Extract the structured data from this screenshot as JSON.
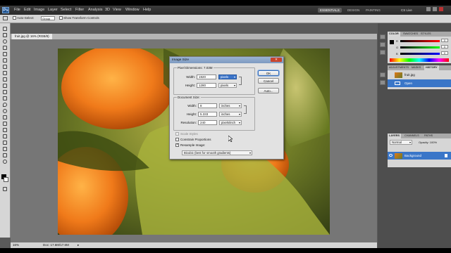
{
  "menu": [
    "File",
    "Edit",
    "Image",
    "Layer",
    "Select",
    "Filter",
    "Analysis",
    "3D",
    "View",
    "Window",
    "Help"
  ],
  "workspaces": {
    "essentials": "ESSENTIALS",
    "design": "DESIGN",
    "painting": "PAINTING",
    "cs_live": "CS Live"
  },
  "options_bar": {
    "auto_select_label": "Auto-Select:",
    "auto_select_value": "Group",
    "show_transform": "Show Transform Controls"
  },
  "document": {
    "tab": "fruit.jpg @ 16% (RGB/8)",
    "zoom": "16%",
    "doc_info": "Doc: 17.6M/17.6M"
  },
  "dialog": {
    "title": "Image Size",
    "pixel_dimensions": "Pixel Dimensions: 7.03M",
    "pixel_width_label": "Width:",
    "pixel_width_value": "1920",
    "pixel_width_unit": "pixels",
    "pixel_height_label": "Height:",
    "pixel_height_value": "1280",
    "pixel_height_unit": "pixels",
    "doc_size_label": "Document Size:",
    "doc_width_label": "Width:",
    "doc_width_value": "8",
    "doc_width_unit": "inches",
    "doc_height_label": "Height:",
    "doc_height_value": "5.333",
    "doc_height_unit": "inches",
    "resolution_label": "Resolution:",
    "resolution_value": "240",
    "resolution_unit": "pixels/inch",
    "scale_styles": "Scale Styles",
    "constrain": "Constrain Proportions",
    "resample": "Resample Image:",
    "resample_method": "Bicubic (best for smooth gradients)",
    "ok": "OK",
    "cancel": "Cancel",
    "auto": "Auto..."
  },
  "panels": {
    "color_tabs": [
      "COLOR",
      "SWATCHES",
      "STYLES"
    ],
    "sliders": [
      {
        "label": "R",
        "value": "0",
        "gradient": "linear-gradient(90deg,#000,#f00)"
      },
      {
        "label": "G",
        "value": "0",
        "gradient": "linear-gradient(90deg,#000,#0f0)"
      },
      {
        "label": "B",
        "value": "0",
        "gradient": "linear-gradient(90deg,#000,#00f)"
      }
    ],
    "history_tabs": [
      "ADJUSTMENTS",
      "MASKS",
      "HISTORY"
    ],
    "history_items": [
      "fruit.jpg",
      "Open"
    ],
    "layers_tabs": [
      "LAYERS",
      "CHANNELS",
      "PATHS"
    ],
    "blend_mode": "Normal",
    "opacity": "Opacity: 100%",
    "layer_name": "Background"
  },
  "colors": {
    "accent": "#3a76c8",
    "dialog_bg": "#e2e2e2",
    "orange": "#f07a1a"
  }
}
